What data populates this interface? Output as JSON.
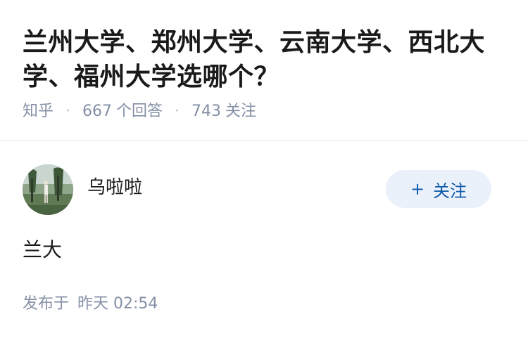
{
  "question": {
    "title": "兰州大学、郑州大学、云南大学、西北大学、福州大学选哪个？",
    "source": "知乎",
    "answer_count": "667",
    "answer_label": "个回答",
    "follow_count": "743",
    "follow_label": "关注"
  },
  "answer": {
    "author_name": "乌啦啦",
    "follow_button": {
      "icon": "+",
      "label": "关注"
    },
    "content": "兰大",
    "time_prefix": "发布于",
    "time_value": "昨天 02:54"
  },
  "colors": {
    "text": "#1a1a1a",
    "meta": "#8590a6",
    "accent": "#0d59a8",
    "button_bg": "#eaf1fb"
  },
  "icons": {
    "avatar": "avatar-photo",
    "follow": "plus-icon"
  }
}
